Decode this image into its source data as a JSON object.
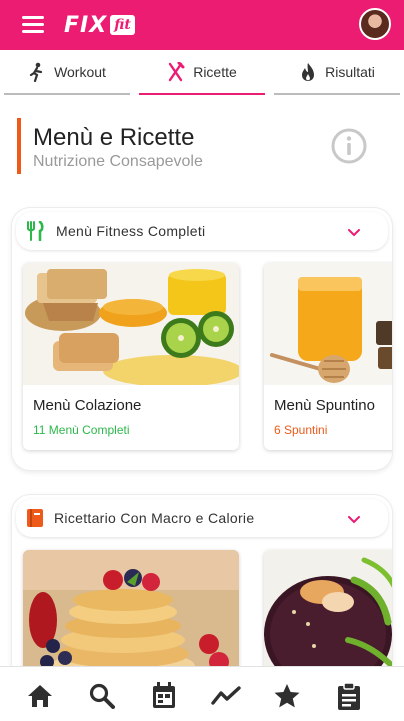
{
  "header": {
    "logo_text": "FIX",
    "logo_badge": "fit",
    "brand_color": "#ec1c73",
    "menu_icon": "hamburger-icon",
    "avatar_icon": "user-avatar"
  },
  "tabs": [
    {
      "label": "Workout",
      "icon": "runner-icon",
      "active": false
    },
    {
      "label": "Ricette",
      "icon": "fork-knife-icon",
      "active": true
    },
    {
      "label": "Risultati",
      "icon": "flame-icon",
      "active": false
    }
  ],
  "page": {
    "title": "Menù e Ricette",
    "subtitle": "Nutrizione Consapevole",
    "accent_color": "#ee5a1a",
    "info_icon": "info-icon"
  },
  "sections": [
    {
      "label": "Menù Fitness Completi",
      "icon": "cutlery-icon",
      "icon_color": "#2db84b",
      "items": [
        {
          "name": "Menù Colazione",
          "count": "11 Menù Completi",
          "count_color": "#2db84b",
          "image": "breakfast-photo"
        },
        {
          "name": "Menù Spuntino",
          "count": "6 Spuntini",
          "count_color": "#ee5a1a",
          "image": "honey-photo"
        }
      ]
    },
    {
      "label": "Ricettario Con Macro e Calorie",
      "icon": "book-icon",
      "icon_color": "#ee5a1a",
      "items": [
        {
          "name": "",
          "count": "",
          "image": "pancakes-photo"
        },
        {
          "name": "",
          "count": "",
          "image": "rice-shrimp-photo"
        }
      ]
    }
  ],
  "bottom_nav": [
    {
      "icon": "home-icon"
    },
    {
      "icon": "search-icon"
    },
    {
      "icon": "calendar-icon"
    },
    {
      "icon": "trend-icon"
    },
    {
      "icon": "star-icon"
    },
    {
      "icon": "clipboard-icon"
    }
  ]
}
